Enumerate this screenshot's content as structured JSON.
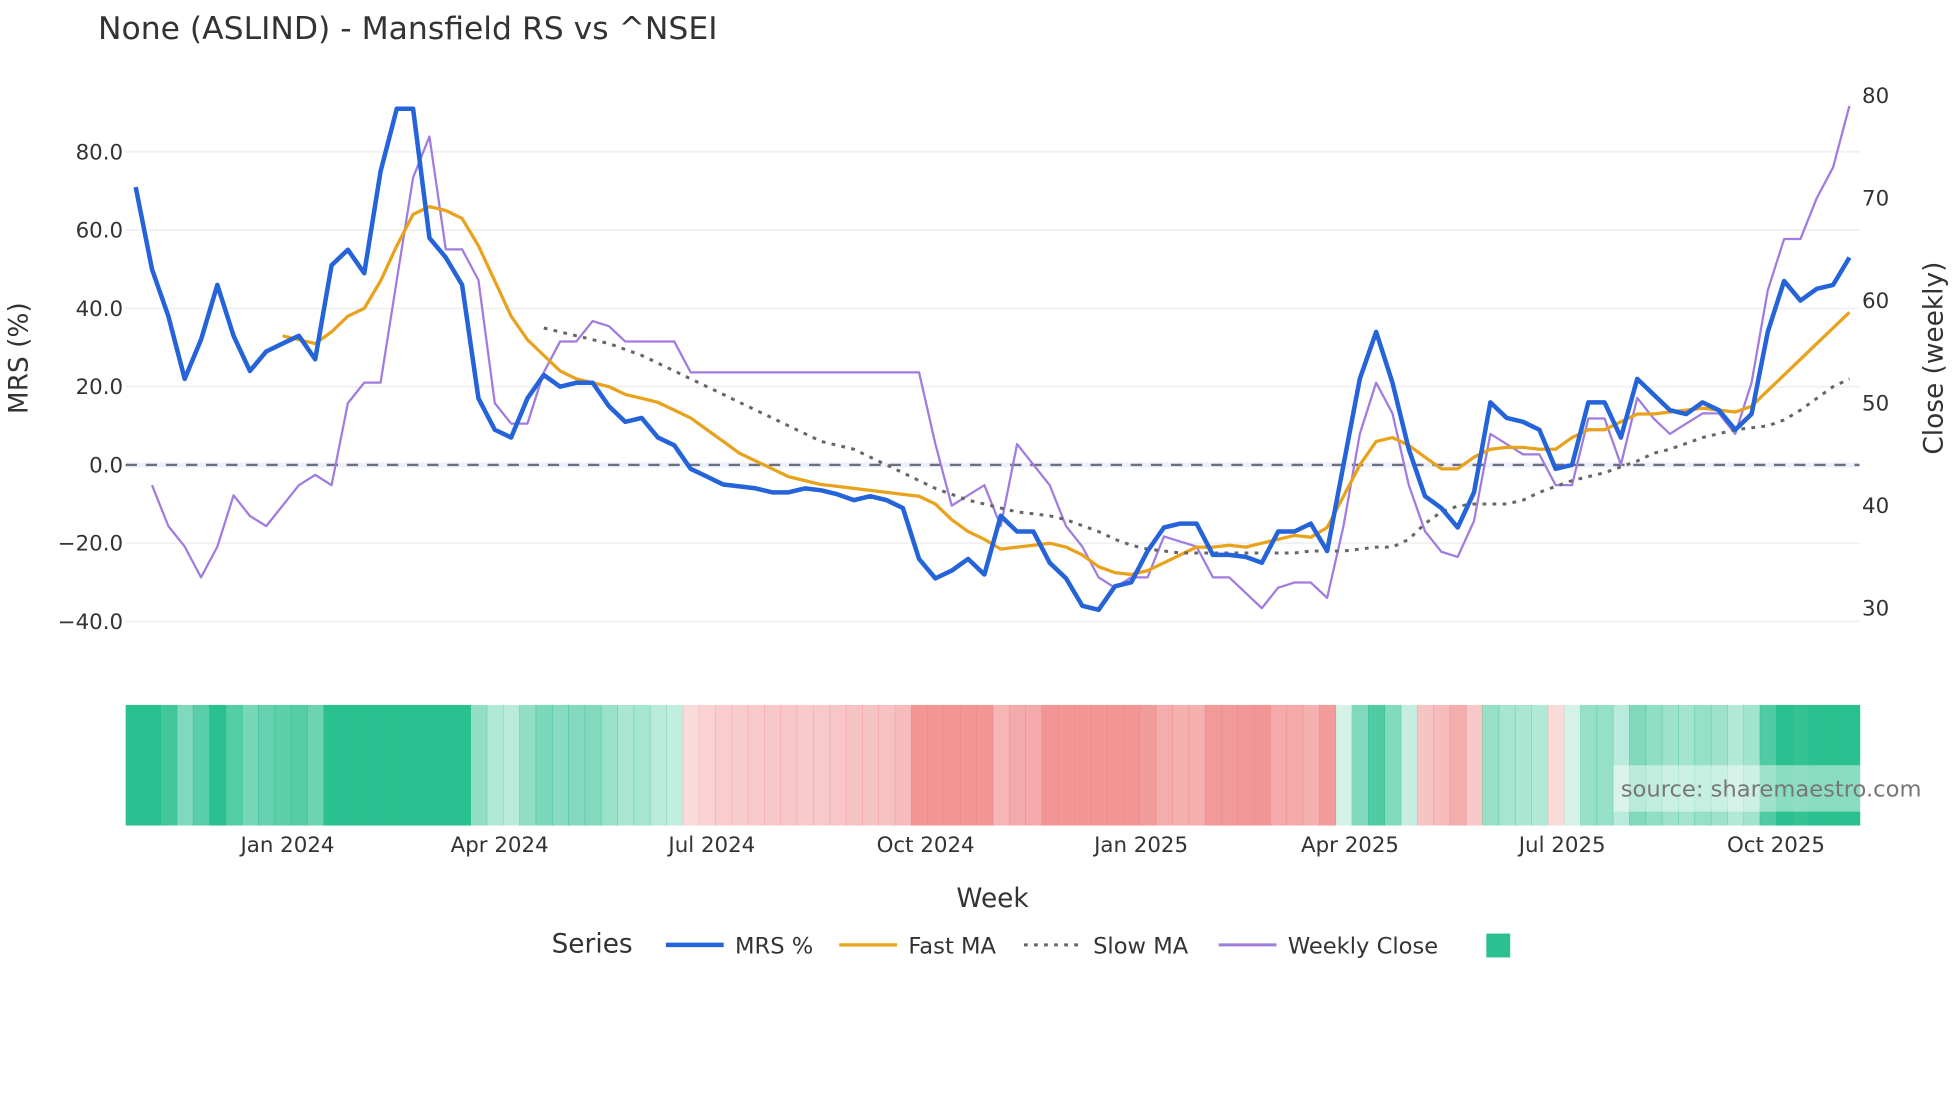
{
  "chart_data": {
    "type": "line",
    "title": "None (ASLIND) - Mansfield RS vs ^NSEI",
    "xlabel": "Week",
    "ylabel": "MRS (%)",
    "y2label": "Close (weekly)",
    "ylim": [
      -46,
      96
    ],
    "y2lim": [
      25,
      84
    ],
    "yticks": [
      -40,
      -20,
      0,
      20,
      40,
      60,
      80
    ],
    "ytick_labels": [
      "−40.0",
      "−20.0",
      "0.0",
      "20.0",
      "40.0",
      "60.0",
      "80.0"
    ],
    "y2ticks": [
      30,
      40,
      50,
      60,
      70,
      80
    ],
    "y2tick_labels": [
      "30",
      "40",
      "50",
      "60",
      "70",
      "80"
    ],
    "xticks": [
      {
        "label": "Jan 2024",
        "week": 9.3
      },
      {
        "label": "Apr 2024",
        "week": 22.3
      },
      {
        "label": "Jul 2024",
        "week": 35.3
      },
      {
        "label": "Oct 2024",
        "week": 48.4
      },
      {
        "label": "Jan 2025",
        "week": 61.6
      },
      {
        "label": "Apr 2025",
        "week": 74.4
      },
      {
        "label": "Jul 2025",
        "week": 87.4
      },
      {
        "label": "Oct 2025",
        "week": 100.5
      }
    ],
    "zero_line": 0,
    "grid": true,
    "legend_title": "Series",
    "legend_position": "bottom",
    "series": [
      {
        "name": "MRS %",
        "color": "#2563d9",
        "axis": "y",
        "values": [
          71,
          50,
          38,
          22,
          32,
          46,
          33,
          24,
          29,
          31,
          33,
          27,
          51,
          55,
          49,
          75,
          91,
          91,
          58,
          53,
          46,
          17,
          9,
          7,
          17,
          23,
          20,
          21,
          21,
          15,
          11,
          12,
          7,
          5,
          -1,
          -3,
          -5,
          -5.5,
          -6,
          -7,
          -7,
          -6,
          -6.5,
          -7.5,
          -9,
          -8,
          -9,
          -11,
          -24,
          -29,
          -27,
          -24,
          -28,
          -13,
          -17,
          -17,
          -25,
          -29,
          -36,
          -37,
          -31,
          -30,
          -22,
          -16,
          -15,
          -15,
          -23,
          -23,
          -23.5,
          -25,
          -17,
          -17,
          -15,
          -22,
          0,
          22,
          34,
          21,
          4,
          -8,
          -11,
          -16,
          -7,
          16,
          12,
          11,
          9,
          -1,
          0,
          16,
          16,
          7,
          22,
          18,
          14,
          13,
          16,
          14,
          9,
          13,
          34,
          47,
          42,
          45,
          46,
          53
        ]
      },
      {
        "name": "Fast MA",
        "color": "#e8a21c",
        "axis": "y",
        "values": [
          33,
          32,
          31,
          34,
          38,
          40,
          47,
          56,
          64,
          66,
          65,
          63,
          56,
          47,
          38,
          32,
          28,
          24,
          22,
          21,
          20,
          18,
          17,
          16,
          14,
          12,
          9,
          6,
          3,
          1,
          -1,
          -3,
          -4,
          -5,
          -5.5,
          -6,
          -6.5,
          -7,
          -7.5,
          -8,
          -10,
          -14,
          -17,
          -19,
          -21.5,
          -21,
          -20.5,
          -20,
          -21,
          -23,
          -26,
          -27.5,
          -28,
          -27,
          -25,
          -23,
          -21,
          -21,
          -20.5,
          -21,
          -20,
          -19,
          -18,
          -18.5,
          -16,
          -8,
          0,
          6,
          7,
          5,
          2,
          -1,
          -1,
          2,
          4,
          4.5,
          4.5,
          4,
          4,
          7,
          9,
          9,
          11,
          13,
          13,
          13.5,
          14,
          14.5,
          14,
          13.5,
          15,
          19,
          23,
          27,
          31,
          35,
          39
        ]
      },
      {
        "name": "Slow MA",
        "color": "#666666",
        "axis": "y",
        "values": [
          35,
          34,
          33,
          32,
          31,
          29.5,
          28,
          26,
          24,
          22,
          20,
          18,
          16,
          14,
          12,
          10,
          8,
          6,
          5,
          4,
          2,
          0,
          -2,
          -4,
          -6,
          -7.5,
          -9,
          -10,
          -11,
          -12,
          -12.5,
          -13,
          -14,
          -15.5,
          -17,
          -19,
          -20.5,
          -21.5,
          -22,
          -22.5,
          -22.5,
          -22.5,
          -22.5,
          -22.5,
          -22.5,
          -22.5,
          -22.5,
          -22,
          -22,
          -22,
          -21.5,
          -21,
          -21,
          -19,
          -15,
          -12,
          -10.5,
          -10,
          -10,
          -10,
          -9,
          -7,
          -5.5,
          -4,
          -3,
          -2,
          -0.5,
          1,
          3,
          4,
          5.5,
          7,
          8,
          9,
          9.5,
          10,
          11.5,
          14,
          17,
          20,
          22
        ]
      },
      {
        "name": "Weekly Close",
        "color": "#a07be0",
        "axis": "y2",
        "values": [
          42,
          38,
          36,
          33,
          36,
          41,
          39,
          38,
          40,
          42,
          43,
          42,
          50,
          52,
          52,
          62,
          72,
          76,
          65,
          65,
          62,
          50,
          48,
          48,
          53,
          56,
          56,
          58,
          57.5,
          56,
          56,
          56,
          56,
          53,
          53,
          53,
          53,
          53,
          53,
          53,
          53,
          53,
          53,
          53,
          53,
          53,
          53,
          53,
          46,
          40,
          41,
          42,
          38,
          46,
          44,
          42,
          38,
          36,
          33,
          32,
          33,
          33,
          37,
          36.5,
          36,
          33,
          33,
          31.5,
          30,
          32,
          32.5,
          32.5,
          31,
          38,
          47,
          52,
          49,
          42,
          37.5,
          35.5,
          35,
          38.5,
          47,
          46,
          45,
          45,
          42,
          42,
          48.5,
          48.5,
          44,
          50.5,
          48.5,
          47,
          48,
          49,
          49,
          47,
          52,
          61,
          66,
          66,
          70,
          73,
          79
        ]
      }
    ],
    "heatmap_legend_color": "#2bc08f"
  },
  "source": "source: sharemaestro.com"
}
